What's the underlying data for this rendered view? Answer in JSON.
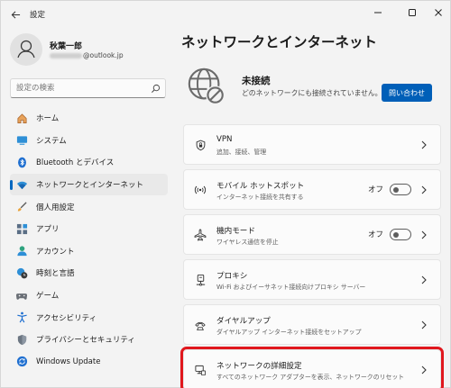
{
  "window": {
    "title": "設定",
    "minimize_icon": "minimize-icon",
    "maximize_icon": "maximize-icon",
    "close_icon": "close-icon"
  },
  "profile": {
    "name": "秋葉一郎",
    "email_suffix": "@outlook.jp"
  },
  "search": {
    "placeholder": "設定の検索"
  },
  "sidebar": {
    "items": [
      {
        "label": "ホーム",
        "icon": "home-icon"
      },
      {
        "label": "システム",
        "icon": "system-icon"
      },
      {
        "label": "Bluetooth とデバイス",
        "icon": "bluetooth-icon"
      },
      {
        "label": "ネットワークとインターネット",
        "icon": "wifi-icon",
        "active": true
      },
      {
        "label": "個人用設定",
        "icon": "brush-icon"
      },
      {
        "label": "アプリ",
        "icon": "apps-icon"
      },
      {
        "label": "アカウント",
        "icon": "account-icon"
      },
      {
        "label": "時刻と言語",
        "icon": "time-language-icon"
      },
      {
        "label": "ゲーム",
        "icon": "gamepad-icon"
      },
      {
        "label": "アクセシビリティ",
        "icon": "accessibility-icon"
      },
      {
        "label": "プライバシーとセキュリティ",
        "icon": "shield-icon"
      },
      {
        "label": "Windows Update",
        "icon": "update-icon"
      }
    ]
  },
  "main": {
    "title": "ネットワークとインターネット",
    "status": {
      "title": "未接続",
      "description": "どのネットワークにも接続されていません。",
      "button": "問い合わせ"
    },
    "cards": [
      {
        "title": "VPN",
        "subtitle": "追加、接続、管理",
        "icon": "vpn-shield-icon"
      },
      {
        "title": "モバイル ホットスポット",
        "subtitle": "インターネット接続を共有する",
        "icon": "hotspot-icon",
        "toggle": "オフ"
      },
      {
        "title": "機内モード",
        "subtitle": "ワイヤレス通信を停止",
        "icon": "airplane-icon",
        "toggle": "オフ"
      },
      {
        "title": "プロキシ",
        "subtitle": "Wi-Fi およびイーサネット接続向けプロキシ サーバー",
        "icon": "proxy-icon"
      },
      {
        "title": "ダイヤルアップ",
        "subtitle": "ダイヤルアップ インターネット接続をセットアップ",
        "icon": "dialup-icon"
      },
      {
        "title": "ネットワークの詳細設定",
        "subtitle": "すべてのネットワーク アダプターを表示、ネットワークのリセット",
        "icon": "network-adapter-icon",
        "highlighted": true
      }
    ]
  },
  "colors": {
    "accent": "#005fb8",
    "highlight_border": "#e0171d"
  }
}
